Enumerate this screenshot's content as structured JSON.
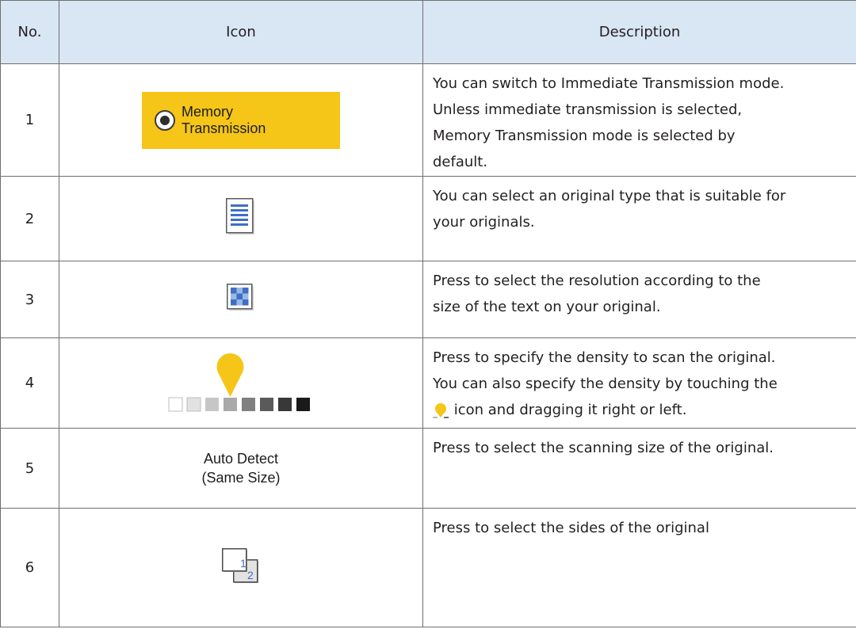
{
  "headers": {
    "no": "No.",
    "icon": "Icon",
    "description": "Description"
  },
  "rows": [
    {
      "no": "1",
      "icon": "memory-transmission-button",
      "icon_text": [
        "Memory",
        "Transmission"
      ],
      "description": [
        "You can switch to Immediate Transmission mode.",
        "Unless immediate transmission is selected,",
        "Memory Transmission mode is selected by",
        "default."
      ]
    },
    {
      "no": "2",
      "icon": "original-type-icon",
      "description": [
        "You can select an original type that is suitable for",
        "your originals."
      ]
    },
    {
      "no": "3",
      "icon": "resolution-icon",
      "description": [
        "Press to select the resolution according to the",
        "size of the text on your original."
      ]
    },
    {
      "no": "4",
      "icon": "density-slider",
      "description": [
        "Press to specify the density to scan the original.",
        "You can also specify the density by touching the",
        " icon and dragging it right or left."
      ]
    },
    {
      "no": "5",
      "icon": "auto-detect-label",
      "icon_text": [
        "Auto Detect",
        "(Same Size)"
      ],
      "description": [
        "Press to select the scanning size of the original."
      ]
    },
    {
      "no": "6",
      "icon": "sides-icon",
      "icon_text": [
        "1",
        "2"
      ],
      "description": [
        "Press to select the sides of the original"
      ]
    }
  ],
  "colors": {
    "header_bg": "#d9e6f4",
    "button_yellow": "#f5c518",
    "icon_blue": "#3f6fc4",
    "border": "#6f6f6f"
  }
}
